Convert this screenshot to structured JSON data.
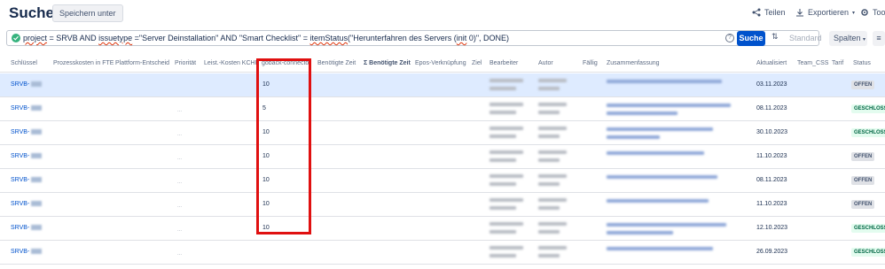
{
  "header": {
    "title": "Suchen",
    "save_label": "Speichern unter",
    "share_label": "Teilen",
    "export_label": "Exportieren",
    "tools_label": "Tools"
  },
  "jql": {
    "query_parts": [
      "project",
      " = SRVB AND ",
      "issuetype",
      " =\"Server Deinstallation\"  AND  \"Smart Checklist\" = ",
      "itemStatus",
      "(\"Herunterfahren des Servers (",
      "init",
      " 0)\", DONE)"
    ],
    "search_label": "Suche",
    "standard_label": "Standard",
    "columns_label": "Spalten"
  },
  "table": {
    "columns": [
      "Schlüssel",
      "Prozesskosten in FTE",
      "Plattform-Entscheid",
      "Priorität",
      "Leist.-Kosten KCHF",
      "goback-connector",
      "Benötigte Zeit",
      "Σ Benötigte Zeit",
      "Epos-Verknüpfung",
      "Ziel",
      "Bearbeiter",
      "Autor",
      "Fällig",
      "Zusammenfassung",
      "Aktualisiert",
      "Team_CSS",
      "Tarif",
      "Status"
    ],
    "rows": [
      {
        "key": "SRVB-",
        "goback": "10",
        "updated": "03.11.2023",
        "status": "OFFEN",
        "status_type": "open"
      },
      {
        "key": "SRVB-",
        "goback": "5",
        "updated": "08.11.2023",
        "status": "GESCHLOSSEN",
        "status_type": "closed"
      },
      {
        "key": "SRVB-",
        "goback": "10",
        "updated": "30.10.2023",
        "status": "GESCHLOSSEN",
        "status_type": "closed"
      },
      {
        "key": "SRVB-",
        "goback": "10",
        "updated": "11.10.2023",
        "status": "OFFEN",
        "status_type": "open"
      },
      {
        "key": "SRVB-",
        "goback": "10",
        "updated": "08.11.2023",
        "status": "OFFEN",
        "status_type": "open"
      },
      {
        "key": "SRVB-",
        "goback": "10",
        "updated": "11.10.2023",
        "status": "OFFEN",
        "status_type": "open"
      },
      {
        "key": "SRVB-",
        "goback": "10",
        "updated": "12.10.2023",
        "status": "GESCHLOSSEN",
        "status_type": "closed"
      },
      {
        "key": "SRVB-",
        "goback": "",
        "updated": "26.09.2023",
        "status": "GESCHLOSSEN",
        "status_type": "closed"
      }
    ],
    "empty_cell": "..."
  },
  "colors": {
    "accent": "#0052cc",
    "highlight_border": "#e01010",
    "selected_row": "#deebff"
  }
}
